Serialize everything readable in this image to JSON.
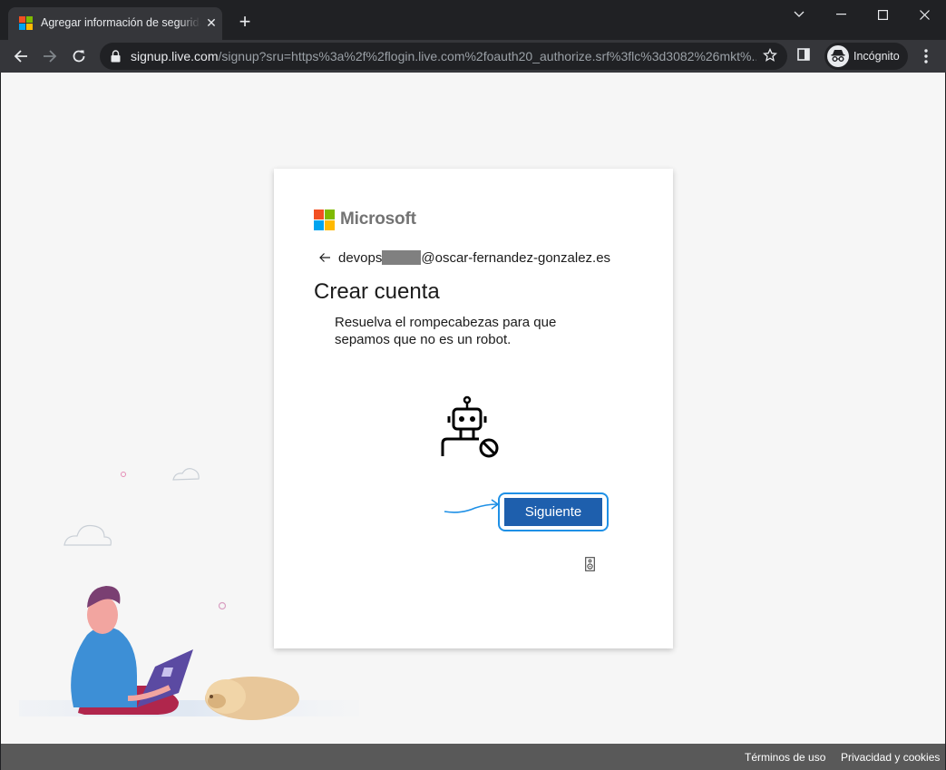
{
  "browser": {
    "tab_title": "Agregar información de seguridad",
    "url_host": "signup.live.com",
    "url_rest": "/signup?sru=https%3a%2f%2flogin.live.com%2foauth20_authorize.srf%3flc%3d3082%26mkt%...",
    "incognito_label": "Incógnito"
  },
  "card": {
    "brand": "Microsoft",
    "identity_prefix": "devops",
    "identity_suffix": "@oscar-fernandez-gonzalez.es",
    "heading": "Crear cuenta",
    "description": "Resuelva el rompecabezas para que sepamos que no es un robot.",
    "next_button": "Siguiente"
  },
  "footer": {
    "terms": "Términos de uso",
    "privacy": "Privacidad y cookies"
  },
  "colors": {
    "ms_red": "#f25022",
    "ms_green": "#7fba00",
    "ms_blue": "#00a4ef",
    "ms_yellow": "#ffb900",
    "primary_button": "#1e5fad",
    "focus_ring": "#1e90e6"
  },
  "icons": [
    "back-arrow-icon",
    "reload-icon",
    "lock-icon",
    "star-icon",
    "incognito-icon",
    "robot-blocked-icon",
    "audio-icon"
  ]
}
